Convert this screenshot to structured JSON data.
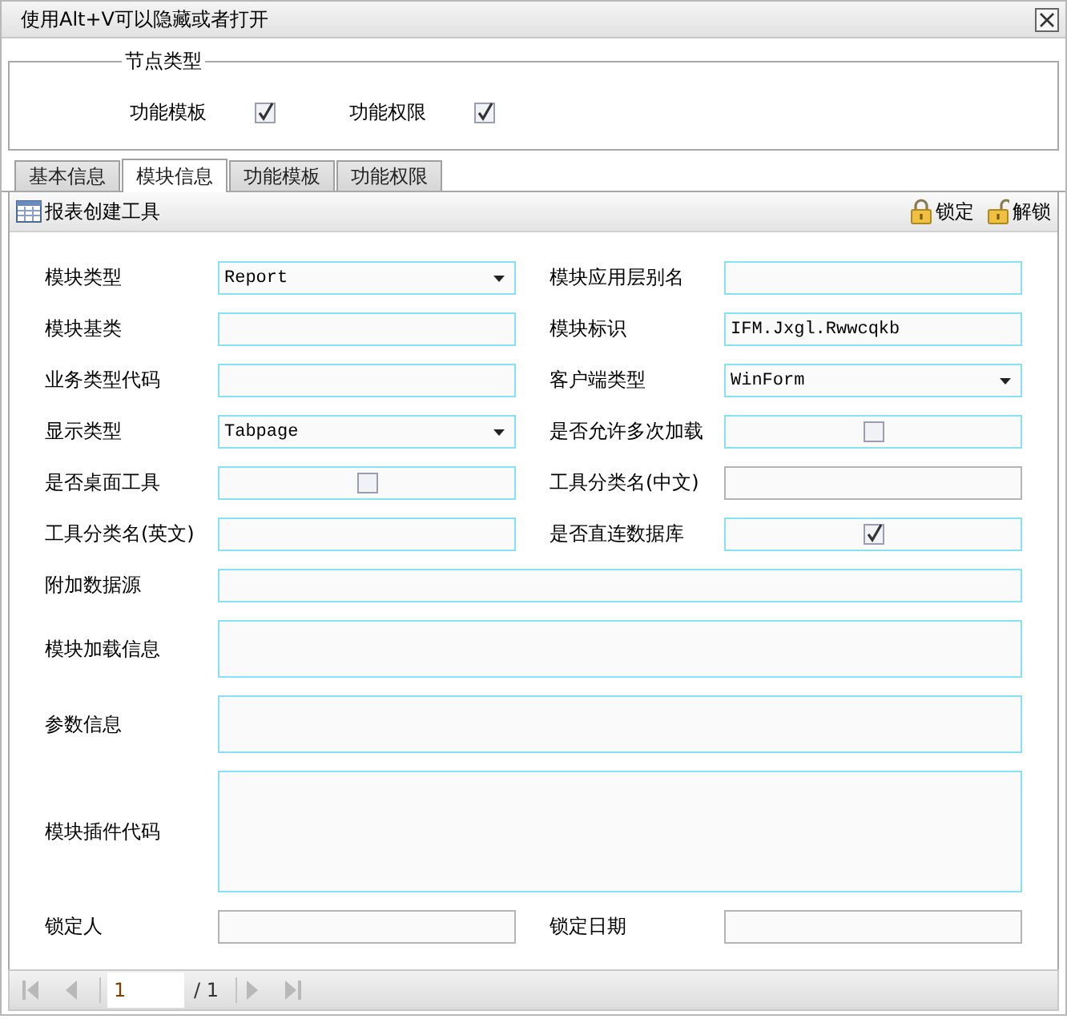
{
  "window": {
    "title": "使用Alt+V可以隐藏或者打开"
  },
  "node_type": {
    "legend": "节点类型",
    "options": [
      {
        "label": "功能模板",
        "checked": true
      },
      {
        "label": "功能权限",
        "checked": true
      }
    ]
  },
  "tabs": [
    {
      "label": "基本信息",
      "selected": false
    },
    {
      "label": "模块信息",
      "selected": true
    },
    {
      "label": "功能模板",
      "selected": false
    },
    {
      "label": "功能权限",
      "selected": false
    }
  ],
  "toolbar": {
    "title": "报表创建工具",
    "actions": [
      {
        "label": "锁定",
        "kind": "lock"
      },
      {
        "label": "解锁",
        "kind": "unlock"
      }
    ]
  },
  "form": {
    "fields": [
      {
        "label": "模块类型",
        "kind": "select",
        "value": "Report",
        "disabled": false
      },
      {
        "label": "模块应用层别名",
        "kind": "text",
        "disabled": false
      },
      {
        "label": "模块基类",
        "kind": "text",
        "disabled": false
      },
      {
        "label": "模块标识",
        "kind": "text",
        "value": "IFM.Jxgl.Rwwcqkb",
        "disabled": false
      },
      {
        "label": "业务类型代码",
        "kind": "text",
        "disabled": false
      },
      {
        "label": "客户端类型",
        "kind": "select",
        "value": "WinForm",
        "disabled": false
      },
      {
        "label": "显示类型",
        "kind": "select",
        "value": "Tabpage",
        "disabled": false
      },
      {
        "label": "是否允许多次加载",
        "kind": "checkbox",
        "checked": false,
        "disabled": false
      },
      {
        "label": "是否桌面工具",
        "kind": "checkbox",
        "checked": false,
        "disabled": false
      },
      {
        "label": "工具分类名(中文)",
        "kind": "text",
        "disabled": true
      },
      {
        "label": "工具分类名(英文)",
        "kind": "text",
        "disabled": false
      },
      {
        "label": "是否直连数据库",
        "kind": "checkbox",
        "checked": true,
        "disabled": false
      },
      {
        "label": "附加数据源",
        "kind": "wide",
        "disabled": false
      },
      {
        "label": "模块加载信息",
        "kind": "memo",
        "disabled": false
      },
      {
        "label": "参数信息",
        "kind": "memo",
        "disabled": false
      },
      {
        "label": "模块插件代码",
        "kind": "code",
        "disabled": false
      },
      {
        "label": "锁定人",
        "kind": "text",
        "disabled": true
      },
      {
        "label": "锁定日期",
        "kind": "text",
        "disabled": true
      }
    ]
  },
  "pager": {
    "page": "1",
    "total": "/ 1"
  }
}
